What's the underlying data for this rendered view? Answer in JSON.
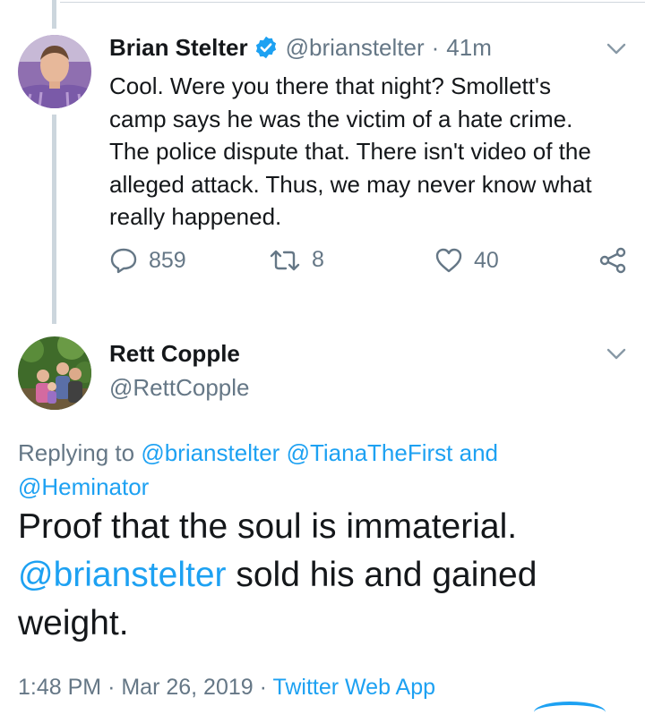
{
  "tweet1": {
    "name": "Brian Stelter",
    "handle": "@brianstelter",
    "separator": "·",
    "time": "41m",
    "text_lines": [
      "Cool. Were you there that night? Smollett's",
      "camp says he was the victim of a hate crime.",
      "The police dispute that. There isn't video of the",
      "alleged attack. Thus, we may never know what",
      "really happened."
    ],
    "replies": "859",
    "retweets": "8",
    "likes": "40",
    "verified": true
  },
  "tweet2": {
    "name": "Rett Copple",
    "handle": "@RettCopple",
    "replying_prefix": "Replying to",
    "replying_to": [
      "@brianstelter",
      "@TianaTheFirst"
    ],
    "replying_and": "and",
    "replying_last": "@Heminator",
    "text_line1": "Proof that the soul is immaterial.",
    "text_mention": "@brianstelter",
    "text_rest": " sold his and gained",
    "text_line3": "weight.",
    "meta_time": "1:48 PM",
    "meta_sep": "·",
    "meta_date": "Mar 26, 2019",
    "meta_sep2": "·",
    "meta_source": "Twitter Web App"
  },
  "colors": {
    "accent": "#1da1f2",
    "secondary_text": "#657786",
    "primary_text": "#14171a",
    "thread_line": "#ccd6dd"
  },
  "icons": {
    "verified": "verified-badge-icon",
    "reply": "reply-bubble-icon",
    "retweet": "retweet-icon",
    "like": "heart-icon",
    "share": "share-icon",
    "menu": "chevron-down-icon"
  }
}
